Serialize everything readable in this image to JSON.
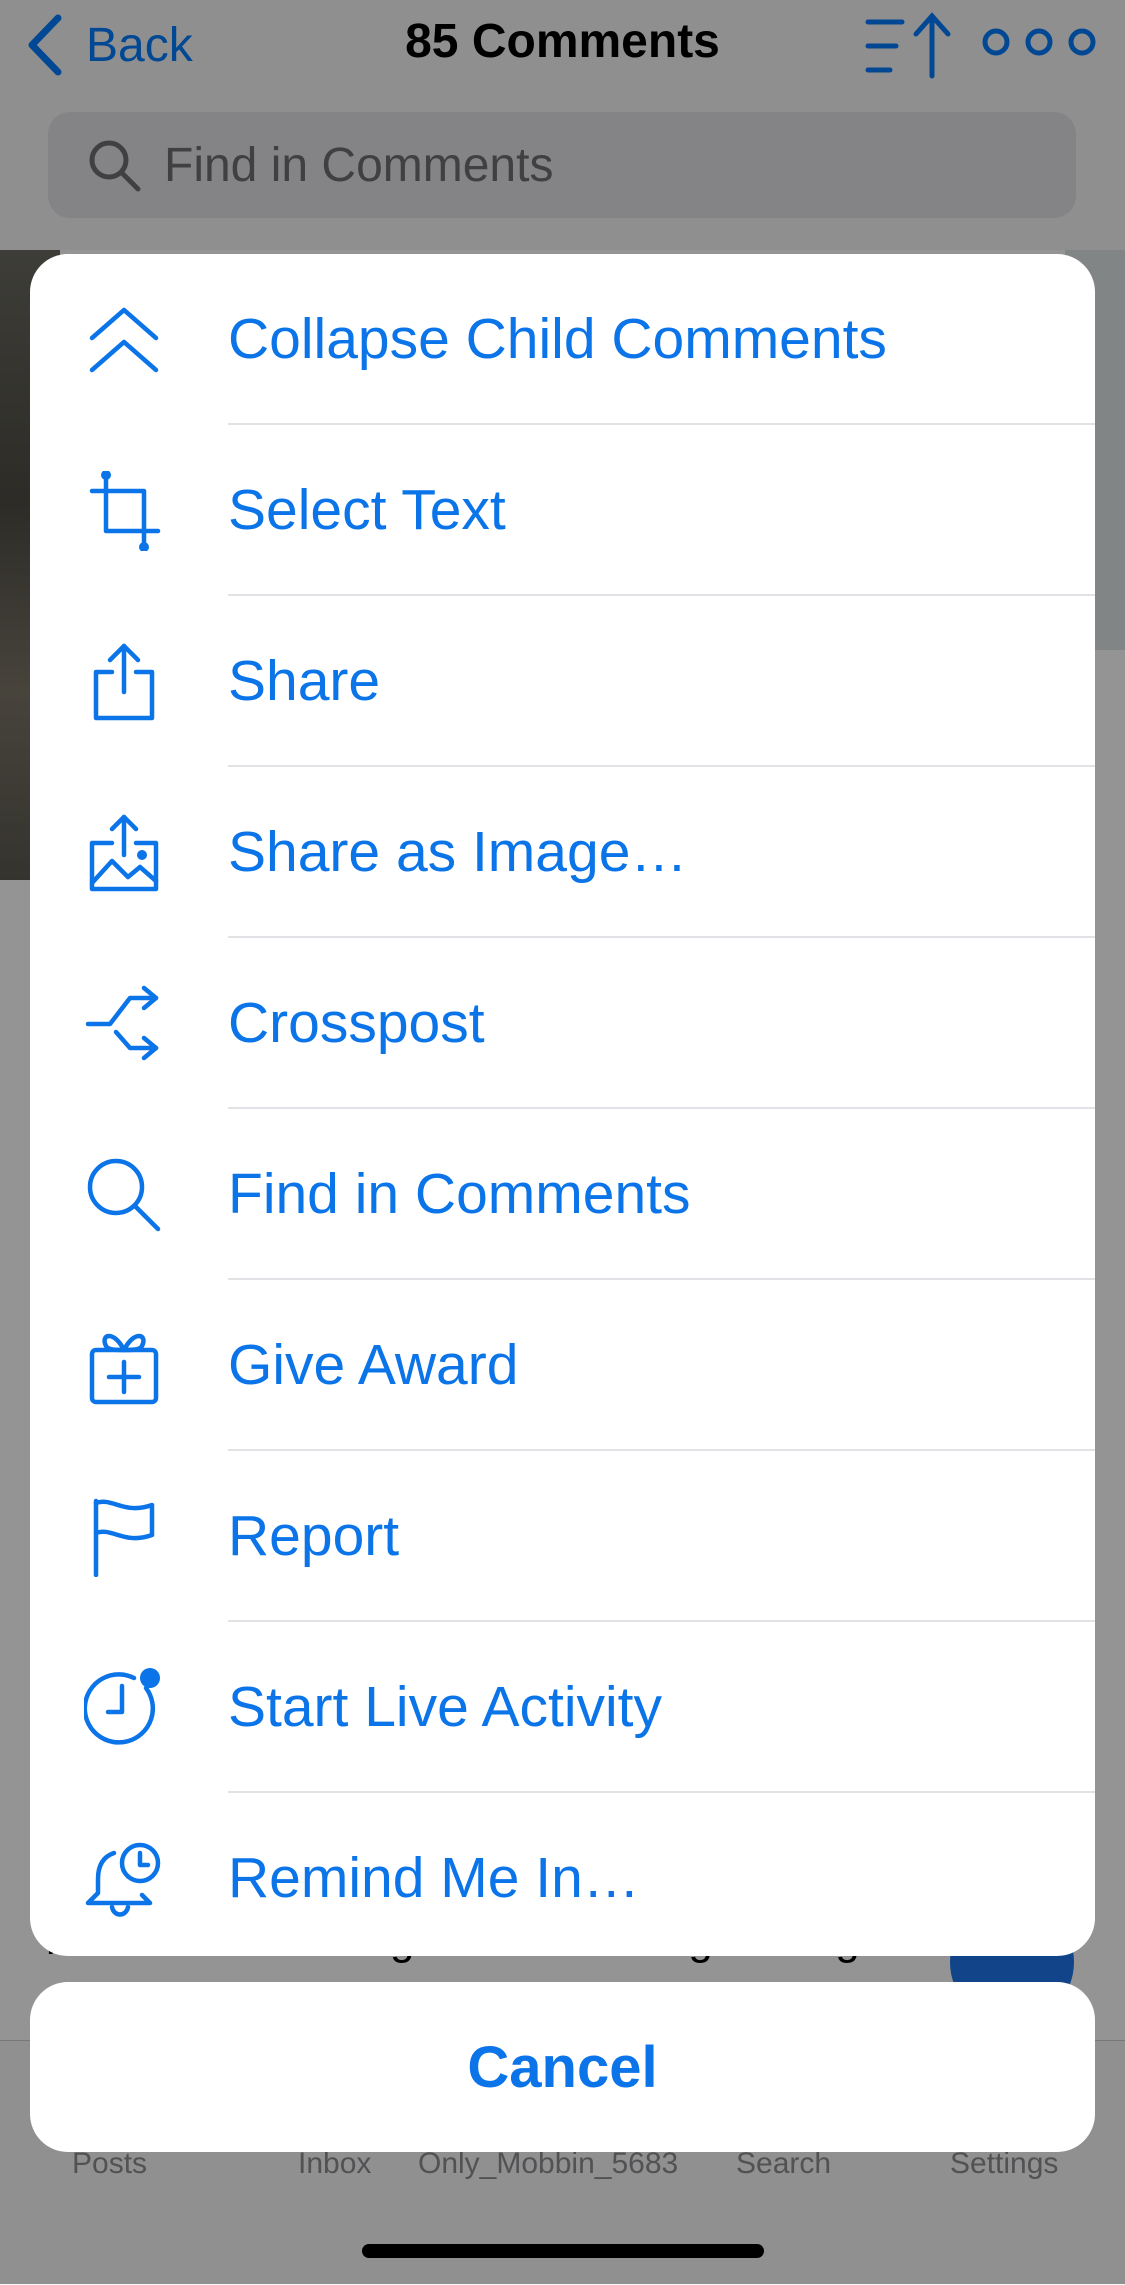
{
  "nav": {
    "back_label": "Back",
    "title": "85 Comments"
  },
  "search": {
    "placeholder": "Find in Comments"
  },
  "post": {
    "visible_text": "before I was 110kg I am now 80kg and I gave"
  },
  "tabs": [
    "Posts",
    "Inbox",
    "Only_Mobbin_5683",
    "Search",
    "Settings"
  ],
  "menu": {
    "items": [
      {
        "label": "Collapse Child Comments",
        "icon": "double-chevron-up-icon"
      },
      {
        "label": "Select Text",
        "icon": "crop-icon"
      },
      {
        "label": "Share",
        "icon": "share-icon"
      },
      {
        "label": "Share as Image…",
        "icon": "share-image-icon"
      },
      {
        "label": "Crosspost",
        "icon": "crosspost-icon"
      },
      {
        "label": "Find in Comments",
        "icon": "search-icon"
      },
      {
        "label": "Give Award",
        "icon": "gift-icon"
      },
      {
        "label": "Report",
        "icon": "flag-icon"
      },
      {
        "label": "Start Live Activity",
        "icon": "clock-badge-icon"
      },
      {
        "label": "Remind Me In…",
        "icon": "bell-clock-icon"
      }
    ],
    "cancel_label": "Cancel"
  },
  "colors": {
    "accent": "#0a74e8",
    "overlay": "rgba(0,0,0,0.42)"
  }
}
